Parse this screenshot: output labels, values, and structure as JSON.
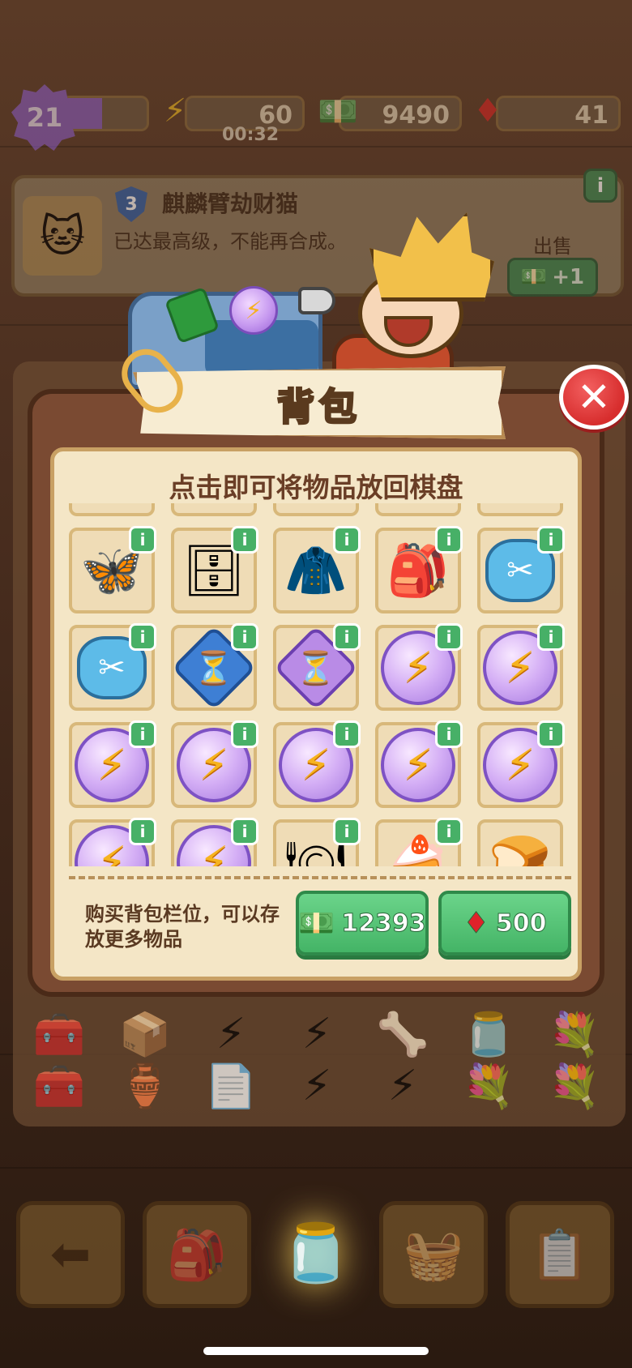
{
  "hud": {
    "level": "21",
    "level_progress": 0.46,
    "energy": "60",
    "energy_timer": "00:32",
    "cash": "9490",
    "gems": "41"
  },
  "info_card": {
    "tier": "3",
    "item_name": "麒麟臂劫财猫",
    "description": "已达最高级，不能再合成。",
    "sell_label": "出售",
    "sell_value": "+1"
  },
  "backpack": {
    "title": "背包",
    "subtitle": "点击即可将物品放回棋盘",
    "items": [
      {
        "icon": "wood-item-icon",
        "glyph": "🪵",
        "info": false,
        "partial": true
      },
      {
        "icon": "robot-item-icon",
        "glyph": "🤖",
        "info": false,
        "partial": true
      },
      {
        "icon": "bottle-item-icon",
        "glyph": "🧴",
        "info": false,
        "partial": true
      },
      {
        "icon": "water-jug-icon",
        "glyph": "💧",
        "info": false,
        "partial": true
      },
      {
        "icon": "hay-icon",
        "glyph": "🌾",
        "info": false,
        "partial": true
      },
      {
        "icon": "moth-icon",
        "glyph": "🦋",
        "info": true,
        "partial": false
      },
      {
        "icon": "cabinet-icon",
        "glyph": "🗄",
        "info": true,
        "partial": false
      },
      {
        "icon": "coat-icon",
        "glyph": "🧥",
        "info": true,
        "partial": false
      },
      {
        "icon": "backpack-icon",
        "glyph": "🎒",
        "info": true,
        "partial": false
      },
      {
        "icon": "scissors-icon",
        "glyph": "✂",
        "info": true,
        "partial": false
      },
      {
        "icon": "scissors-icon",
        "glyph": "✂",
        "info": true,
        "partial": false
      },
      {
        "icon": "hourglass-blue-icon",
        "glyph": "⏳",
        "info": true,
        "partial": false
      },
      {
        "icon": "hourglass-purple-icon",
        "glyph": "⏳",
        "info": true,
        "partial": false
      },
      {
        "icon": "energy-orb-icon",
        "glyph": "⚡",
        "info": true,
        "partial": false
      },
      {
        "icon": "energy-orb-icon",
        "glyph": "⚡",
        "info": true,
        "partial": false
      },
      {
        "icon": "energy-orb-icon",
        "glyph": "⚡",
        "info": true,
        "partial": false
      },
      {
        "icon": "energy-orb-icon",
        "glyph": "⚡",
        "info": true,
        "partial": false
      },
      {
        "icon": "energy-orb-icon",
        "glyph": "⚡",
        "info": true,
        "partial": false
      },
      {
        "icon": "energy-orb-icon",
        "glyph": "⚡",
        "info": true,
        "partial": false
      },
      {
        "icon": "energy-orb-icon",
        "glyph": "⚡",
        "info": true,
        "partial": false
      },
      {
        "icon": "energy-orb-icon",
        "glyph": "⚡",
        "info": true,
        "partial": true
      },
      {
        "icon": "energy-orb-icon",
        "glyph": "⚡",
        "info": true,
        "partial": true
      },
      {
        "icon": "plate-item-icon",
        "glyph": "🍽",
        "info": true,
        "partial": true
      },
      {
        "icon": "cake-plate-icon",
        "glyph": "🍰",
        "info": true,
        "partial": true
      },
      {
        "icon": "bread-icon",
        "glyph": "🍞",
        "info": false,
        "partial": true
      }
    ],
    "buy_text": "购买背包栏位，可以存放更多物品",
    "buy_cash": "12393",
    "buy_gems": "500",
    "info_glyph": "i",
    "close_glyph": "✕"
  },
  "colors": {
    "accent_green": "#47b067",
    "close_red": "#d72d2d",
    "panel_bg": "#f4e6c6",
    "modal_frame": "#7a4a32"
  }
}
